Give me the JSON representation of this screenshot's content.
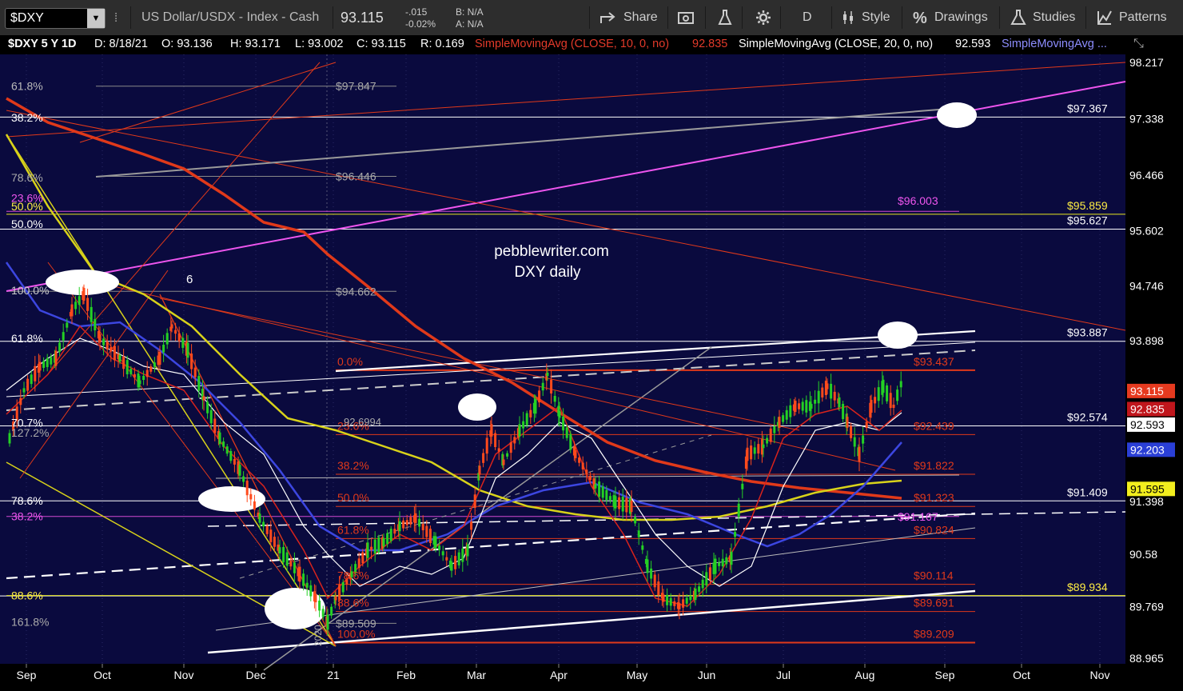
{
  "toolbar": {
    "symbol": "$DXY",
    "description": "US Dollar/USDX - Index - Cash",
    "last": "93.115",
    "change": "-.015",
    "change_pct": "-0.02%",
    "bid": "B: N/A",
    "ask": "A: N/A",
    "share": "Share",
    "period": "D",
    "style": "Style",
    "drawings": "Drawings",
    "studies": "Studies",
    "patterns": "Patterns"
  },
  "infobar": {
    "symbol_period": "$DXY 5 Y 1D",
    "date": "D: 8/18/21",
    "open": "O: 93.136",
    "high": "H: 93.171",
    "low": "L: 93.002",
    "close": "C: 93.115",
    "range": "R: 0.169",
    "sma10_label": "SimpleMovingAvg (CLOSE, 10, 0, no)",
    "sma10_value": "92.835",
    "sma20_label": "SimpleMovingAvg (CLOSE, 20, 0, no)",
    "sma20_value": "92.593",
    "sma_more_label": "SimpleMovingAvg ..."
  },
  "chart_data": {
    "type": "candlestick",
    "watermark": [
      "pebblewriter.com",
      "DXY daily"
    ],
    "x_labels": [
      "Sep",
      "Oct",
      "Nov",
      "Dec",
      "21",
      "Feb",
      "Mar",
      "Apr",
      "May",
      "Jun",
      "Jul",
      "Aug",
      "Sep",
      "Oct",
      "Nov"
    ],
    "y_labels": [
      98.217,
      97.338,
      96.466,
      95.602,
      94.746,
      93.898,
      93.115,
      92.835,
      92.593,
      92.203,
      91.595,
      91.398,
      90.58,
      89.769,
      88.965
    ],
    "y_range": [
      88.9,
      98.3
    ],
    "price_badges": [
      {
        "value": "93.115",
        "color": "#e63a1f"
      },
      {
        "value": "92.835",
        "color": "#c0161c"
      },
      {
        "value": "92.593",
        "color": "#ffffff"
      },
      {
        "value": "92.203",
        "color": "#2a3fd6"
      },
      {
        "value": "91.595",
        "color": "#f2ee1e"
      }
    ],
    "levels_right": [
      {
        "label": "$97.367",
        "value": 97.367
      },
      {
        "label": "$95.627",
        "value": 95.627
      },
      {
        "label": "$93.887",
        "value": 93.887
      },
      {
        "label": "$92.574",
        "value": 92.574
      },
      {
        "label": "$91.409",
        "value": 91.409
      },
      {
        "label": "$89.934",
        "value": 89.934
      }
    ],
    "levels_fib_orange": [
      {
        "label": "0.0%",
        "price": "$93.437",
        "value": 93.437
      },
      {
        "label": "23.6%",
        "price": "$92.439",
        "value": 92.439
      },
      {
        "label": "38.2%",
        "price": "$91.822",
        "value": 91.822
      },
      {
        "label": "50.0%",
        "price": "$91.323",
        "value": 91.323
      },
      {
        "label": "61.8%",
        "price": "$90.824",
        "value": 90.824
      },
      {
        "label": "78.6%",
        "price": "$90.114",
        "value": 90.114
      },
      {
        "label": "88.6%",
        "price": "$89.691",
        "value": 89.691
      },
      {
        "label": "100.0%",
        "price": "$89.209",
        "value": 89.209
      }
    ],
    "levels_grey": [
      {
        "label": "$97.847",
        "value": 97.847
      },
      {
        "label": "$96.446",
        "value": 96.446
      },
      {
        "label": "$94.662",
        "value": 94.662
      },
      {
        "label": "$89.509",
        "value": 89.509
      }
    ],
    "levels_left": [
      {
        "label": "61.8%",
        "value": 97.85
      },
      {
        "label": "38.2%",
        "value": 97.36
      },
      {
        "label": "78.6%",
        "value": 96.43
      },
      {
        "label": "23.6%",
        "value": 96.11
      },
      {
        "label": "50.0%",
        "value": 95.98
      },
      {
        "label": "50.0%",
        "value": 95.71
      },
      {
        "label": "100.0%",
        "value": 94.68
      },
      {
        "label": "61.8%",
        "value": 93.93
      },
      {
        "label": "70.7%",
        "value": 92.62
      },
      {
        "label": "127.2%",
        "value": 92.47
      },
      {
        "label": "78.6%",
        "value": 91.41
      },
      {
        "label": "38.2%",
        "value": 91.17
      },
      {
        "label": "88.6%",
        "value": 89.94
      },
      {
        "label": "161.8%",
        "value": 89.53
      }
    ],
    "magenta_level": {
      "label": "$96.003",
      "value": 96.003
    },
    "magenta_level2": {
      "label": "$91.167",
      "value": 91.167
    },
    "yellow_level": {
      "label": "$95.859",
      "value": 95.859
    },
    "annotation_6": "6",
    "annotation_26994": "92.6994",
    "annotation_2020": "2020"
  }
}
